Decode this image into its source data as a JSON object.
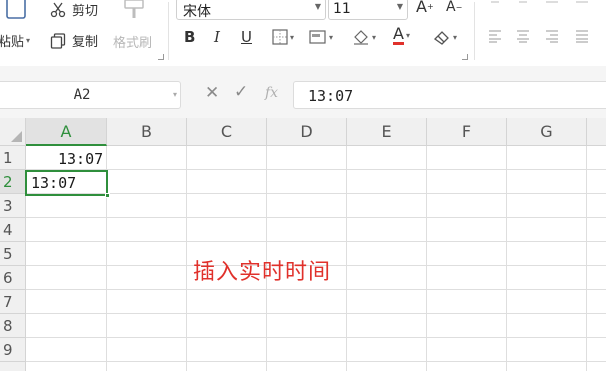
{
  "ribbon": {
    "paste_label": "粘贴",
    "cut_label": "剪切",
    "copy_label": "复制",
    "format_painter_label": "格式刷",
    "font_name": "宋体",
    "font_size": "11",
    "increase_font": "A",
    "decrease_font": "A",
    "bold": "B",
    "italic": "I",
    "underline": "U",
    "font_color_glyph": "A",
    "font_color": "#e0312b"
  },
  "formula_bar": {
    "name_box": "A2",
    "fx_label": "fx",
    "content": "13:07"
  },
  "grid": {
    "columns": [
      "A",
      "B",
      "C",
      "D",
      "E",
      "F",
      "G"
    ],
    "rows": [
      "1",
      "2",
      "3",
      "4",
      "5",
      "6",
      "7",
      "8",
      "9"
    ],
    "active_column": "A",
    "active_row": "2",
    "cells": {
      "A1": "13:07",
      "A2": "13:07"
    }
  },
  "annotation": "插入实时时间",
  "colors": {
    "accent": "#2f8f3c",
    "annotation": "#e0312b"
  }
}
